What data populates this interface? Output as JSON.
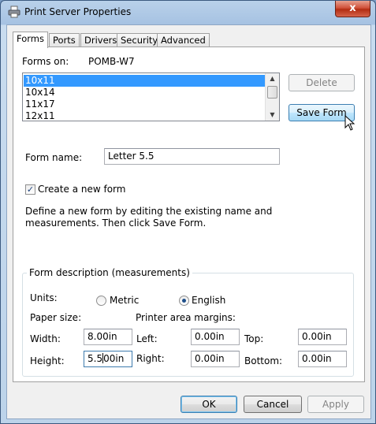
{
  "window": {
    "title": "Print Server Properties",
    "close_symbol": "x"
  },
  "tabs": [
    "Forms",
    "Ports",
    "Drivers",
    "Security",
    "Advanced"
  ],
  "forms": {
    "forms_on_label": "Forms on:",
    "server_name": "POMB-W7",
    "list_items": [
      "10x11",
      "10x14",
      "11x17",
      "12x11"
    ],
    "selected_index": 0,
    "delete_label": "Delete",
    "save_form_label": "Save Form",
    "form_name_label": "Form name:",
    "form_name_value": "Letter 5.5",
    "create_new_form_label": "Create a new form",
    "create_new_form_checked": true,
    "description_text_line1": "Define a new form by editing the existing name and",
    "description_text_line2": "measurements. Then click Save Form.",
    "group_title": "Form description (measurements)",
    "units_label": "Units:",
    "metric_label": "Metric",
    "english_label": "English",
    "units_selected": "English",
    "paper_size_label": "Paper size:",
    "printer_margins_label": "Printer area margins:",
    "width_label": "Width:",
    "width_value": "8.00in",
    "height_label": "Height:",
    "height_value_before_caret": "5.5",
    "height_value_after_caret": "00in",
    "left_label": "Left:",
    "left_value": "0.00in",
    "right_label": "Right:",
    "right_value": "0.00in",
    "top_label": "Top:",
    "top_value": "0.00in",
    "bottom_label": "Bottom:",
    "bottom_value": "0.00in"
  },
  "footer": {
    "ok_label": "OK",
    "cancel_label": "Cancel",
    "apply_label": "Apply"
  },
  "colors": {
    "selection": "#3399ff",
    "accent": "#3c7fb1",
    "close": "#c7432b"
  }
}
